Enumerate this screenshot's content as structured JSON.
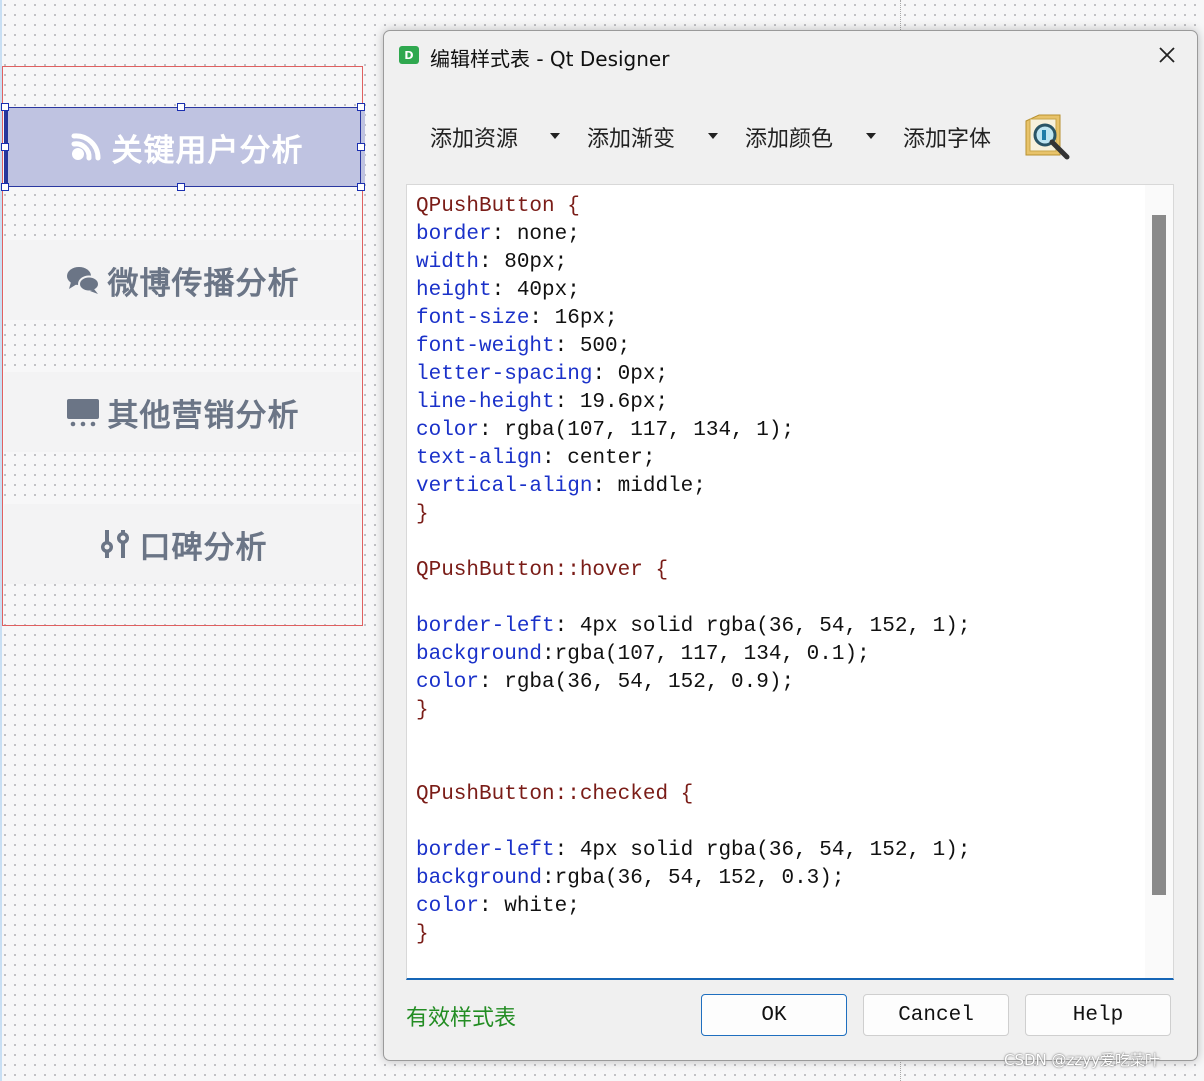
{
  "form": {
    "buttons": [
      {
        "label": "关键用户分析",
        "icon": "broadcast-icon",
        "checked": true
      },
      {
        "label": "微博传播分析",
        "icon": "chat-bubbles-icon",
        "checked": false
      },
      {
        "label": "其他营销分析",
        "icon": "monitor-icon",
        "checked": false
      },
      {
        "label": "口碑分析",
        "icon": "sliders-icon",
        "checked": false
      }
    ]
  },
  "dialog": {
    "title": "编辑样式表 - Qt Designer",
    "app_icon_letter": "D",
    "toolbar": {
      "add_resource": "添加资源",
      "add_gradient": "添加渐变",
      "add_color": "添加颜色",
      "add_font": "添加字体"
    },
    "code_lines": [
      [
        {
          "t": "QPushButton {",
          "c": "sel"
        }
      ],
      [
        {
          "t": "border",
          "c": "prop"
        },
        {
          "t": ": none;",
          "c": ""
        }
      ],
      [
        {
          "t": "width",
          "c": "prop"
        },
        {
          "t": ": 80px;",
          "c": ""
        }
      ],
      [
        {
          "t": "height",
          "c": "prop"
        },
        {
          "t": ": 40px;",
          "c": ""
        }
      ],
      [
        {
          "t": "font-size",
          "c": "prop"
        },
        {
          "t": ": 16px;",
          "c": ""
        }
      ],
      [
        {
          "t": "font-weight",
          "c": "prop"
        },
        {
          "t": ": 500;",
          "c": ""
        }
      ],
      [
        {
          "t": "letter-spacing",
          "c": "prop"
        },
        {
          "t": ": 0px;",
          "c": ""
        }
      ],
      [
        {
          "t": "line-height",
          "c": "prop"
        },
        {
          "t": ": 19.6px;",
          "c": ""
        }
      ],
      [
        {
          "t": "color",
          "c": "prop"
        },
        {
          "t": ": rgba(107, 117, 134, 1);",
          "c": ""
        }
      ],
      [
        {
          "t": "text-align",
          "c": "prop"
        },
        {
          "t": ": center;",
          "c": ""
        }
      ],
      [
        {
          "t": "vertical-align",
          "c": "prop"
        },
        {
          "t": ": middle;",
          "c": ""
        }
      ],
      [
        {
          "t": "}",
          "c": "sel"
        }
      ],
      [],
      [
        {
          "t": "QPushButton::hover {",
          "c": "sel"
        }
      ],
      [],
      [
        {
          "t": "border-left",
          "c": "prop"
        },
        {
          "t": ": 4px solid rgba(36, 54, 152, 1);",
          "c": ""
        }
      ],
      [
        {
          "t": "background",
          "c": "prop"
        },
        {
          "t": ":rgba(107, 117, 134, 0.1);",
          "c": ""
        }
      ],
      [
        {
          "t": "color",
          "c": "prop"
        },
        {
          "t": ": rgba(36, 54, 152, 0.9);",
          "c": ""
        }
      ],
      [
        {
          "t": "}",
          "c": "sel"
        }
      ],
      [],
      [],
      [
        {
          "t": "QPushButton::checked {",
          "c": "sel"
        }
      ],
      [],
      [
        {
          "t": "border-left",
          "c": "prop"
        },
        {
          "t": ": 4px solid rgba(36, 54, 152, 1);",
          "c": ""
        }
      ],
      [
        {
          "t": "background",
          "c": "prop"
        },
        {
          "t": ":rgba(36, 54, 152, 0.3);",
          "c": ""
        }
      ],
      [
        {
          "t": "color",
          "c": "prop"
        },
        {
          "t": ": white;",
          "c": ""
        }
      ],
      [
        {
          "t": "}",
          "c": "sel"
        }
      ]
    ],
    "status": "有效样式表",
    "buttons": {
      "ok": "OK",
      "cancel": "Cancel",
      "help": "Help"
    }
  },
  "watermark": "CSDN @zzyy爱吃菜叶",
  "colors": {
    "checked_bg": "#bfc3e1",
    "accent": "#243698",
    "text_gray": "#6b7586",
    "code_selector": "#7a1c17",
    "code_property": "#1a31c9",
    "valid_status": "#238d23"
  }
}
